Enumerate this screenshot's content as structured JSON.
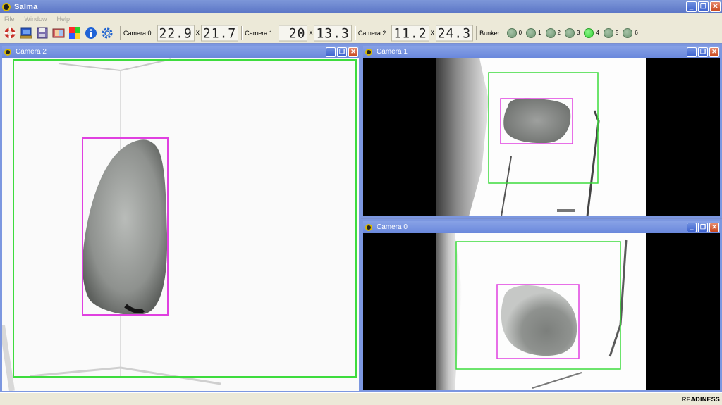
{
  "window": {
    "title": "Salma",
    "buttons": {
      "minimize": "_",
      "restore": "❐",
      "close": "✕"
    }
  },
  "menu": [
    "File",
    "Window",
    "Help"
  ],
  "toolbar": {
    "tools": [
      "lifebuoy-icon",
      "monitor-icon",
      "save-icon",
      "film-icon",
      "color-palette-icon",
      "info-icon",
      "settings-gear-icon"
    ],
    "camera0": {
      "label": "Camera 0 :",
      "width": "22.9",
      "x": "x",
      "height": "21.7"
    },
    "camera1": {
      "label": "Camera 1 :",
      "width": "20",
      "x": "x",
      "height": "13.3"
    },
    "camera2": {
      "label": "Camera 2 :",
      "width": "11.2",
      "x": "x",
      "height": "24.3"
    },
    "bunker": {
      "label": "Bunker :",
      "items": [
        {
          "label": "0",
          "active": false
        },
        {
          "label": "1",
          "active": false
        },
        {
          "label": "2",
          "active": false
        },
        {
          "label": "3",
          "active": false
        },
        {
          "label": "4",
          "active": true
        },
        {
          "label": "5",
          "active": false
        },
        {
          "label": "6",
          "active": false
        }
      ]
    }
  },
  "windows": {
    "camera2": {
      "title": "Camera 2"
    },
    "camera1": {
      "title": "Camera 1"
    },
    "camera0": {
      "title": "Camera 0"
    }
  },
  "status": {
    "text": "READINESS"
  },
  "colors": {
    "roi_outer": "#3ddc3d",
    "roi_inner": "#e040e0",
    "mdi_background": "#7b8fcf",
    "titlebar": "#6a88dc"
  }
}
